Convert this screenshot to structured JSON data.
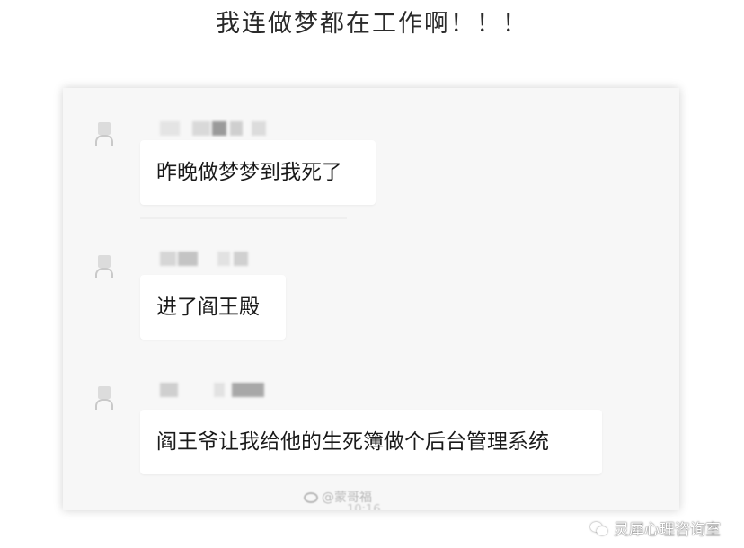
{
  "headline": "我连做梦都在工作啊！！！",
  "chat": {
    "messages": [
      {
        "text": "昨晚做梦梦到我死了"
      },
      {
        "text": "进了阎王殿"
      },
      {
        "text": "阎王爷让我给他的生死簿做个后台管理系统"
      }
    ],
    "footer_watermark": "@蒙哥福",
    "footer_time": "10:16"
  },
  "corner_watermark": "灵犀心理咨询室",
  "icons": {
    "avatar": "user-avatar-icon",
    "weibo": "weibo-icon",
    "wechat": "wechat-icon"
  },
  "colors": {
    "page_bg": "#ffffff",
    "chat_bg": "#f7f7f7",
    "bubble_bg": "#ffffff",
    "text": "#1a1a1a"
  }
}
